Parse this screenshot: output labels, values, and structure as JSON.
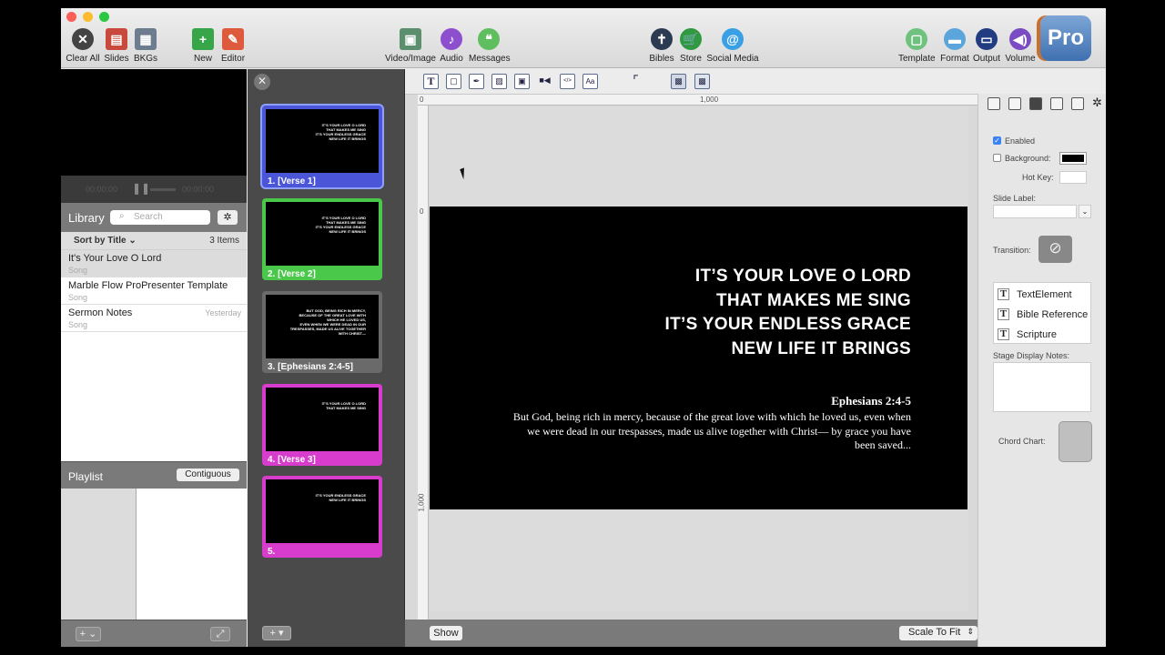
{
  "toolbar": {
    "items": [
      {
        "label": "Clear All",
        "icon": "clear-all-icon"
      },
      {
        "label": "Slides",
        "icon": "slides-icon"
      },
      {
        "label": "BKGs",
        "icon": "backgrounds-icon"
      },
      {
        "label": "New",
        "icon": "new-icon"
      },
      {
        "label": "Editor",
        "icon": "editor-icon"
      },
      {
        "label": "Video/Image",
        "icon": "video-image-icon"
      },
      {
        "label": "Audio",
        "icon": "audio-icon"
      },
      {
        "label": "Messages",
        "icon": "messages-icon"
      },
      {
        "label": "Bibles",
        "icon": "bibles-icon"
      },
      {
        "label": "Store",
        "icon": "store-icon"
      },
      {
        "label": "Social Media",
        "icon": "social-media-icon"
      },
      {
        "label": "Template",
        "icon": "template-icon"
      },
      {
        "label": "Format",
        "icon": "format-icon"
      },
      {
        "label": "Output",
        "icon": "output-icon"
      },
      {
        "label": "Volume",
        "icon": "volume-icon"
      }
    ],
    "logo": "Pro"
  },
  "transport": {
    "elapsed": "00:00:00",
    "remaining": "00:00:00"
  },
  "library": {
    "title": "Library",
    "search_placeholder": "Search",
    "sort_label": "Sort by Title",
    "count": "3 Items",
    "items": [
      {
        "title": "It's Your Love O Lord",
        "subtitle": "Song",
        "date": ""
      },
      {
        "title": "Marble Flow ProPresenter Template",
        "subtitle": "Song",
        "date": ""
      },
      {
        "title": "Sermon Notes",
        "subtitle": "Song",
        "date": "Yesterday"
      }
    ]
  },
  "playlist": {
    "title": "Playlist",
    "mode_button": "Contiguous"
  },
  "slides": [
    {
      "label": "1. [Verse 1]",
      "color": "#4a55d8",
      "lines": [
        "IT'S YOUR LOVE O LORD",
        "THAT MAKES ME SING",
        "IT'S YOUR ENDLESS GRACE",
        "NEW LIFE IT BRINGS"
      ]
    },
    {
      "label": "2. [Verse 2]",
      "color": "#49c84a",
      "lines": [
        "IT'S YOUR LOVE O LORD",
        "THAT MAKES ME SING",
        "IT'S YOUR ENDLESS GRACE",
        "NEW LIFE IT BRINGS"
      ]
    },
    {
      "label": "3. [Ephesians 2:4-5]",
      "color": "#6a6a6a",
      "lines": [
        "BUT GOD, BEING RICH IN MERCY,",
        "BECAUSE OF THE GREAT LOVE WITH",
        "WHICH HE LOVED US,",
        "EVEN WHEN WE WERE DEAD IN OUR",
        "TRESPASSES, MADE US ALIVE TOGETHER",
        "WITH CHRIST—"
      ]
    },
    {
      "label": "4. [Verse 3]",
      "color": "#d83ccc",
      "lines": [
        "IT'S YOUR LOVE O LORD",
        "THAT MAKES ME SING"
      ]
    },
    {
      "label": "5.",
      "color": "#d83ccc",
      "lines": [
        "IT'S YOUR ENDLESS GRACE",
        "NEW LIFE IT BRINGS"
      ]
    }
  ],
  "editor": {
    "ruler_h": [
      "0",
      "1,000"
    ],
    "ruler_v": [
      "0",
      "1,000"
    ],
    "lyrics": [
      "IT’S YOUR LOVE O LORD",
      "THAT MAKES ME SING",
      "IT’S YOUR ENDLESS GRACE",
      "NEW LIFE IT BRINGS"
    ],
    "scripture_ref": "Ephesians 2:4-5",
    "scripture_text": "But God, being rich in mercy, because of the great love with which he loved us, even when we were dead in our trespasses, made us alive together with Christ— by grace you have been saved...",
    "show_button": "Show",
    "scale": "Scale To Fit"
  },
  "inspector": {
    "enabled_label": "Enabled",
    "background_label": "Background:",
    "hotkey_label": "Hot Key:",
    "slide_label_label": "Slide Label:",
    "transition_label": "Transition:",
    "elements": [
      "TextElement",
      "Bible Reference",
      "Scripture"
    ],
    "stage_notes_label": "Stage Display Notes:",
    "chord_chart_label": "Chord Chart:"
  }
}
